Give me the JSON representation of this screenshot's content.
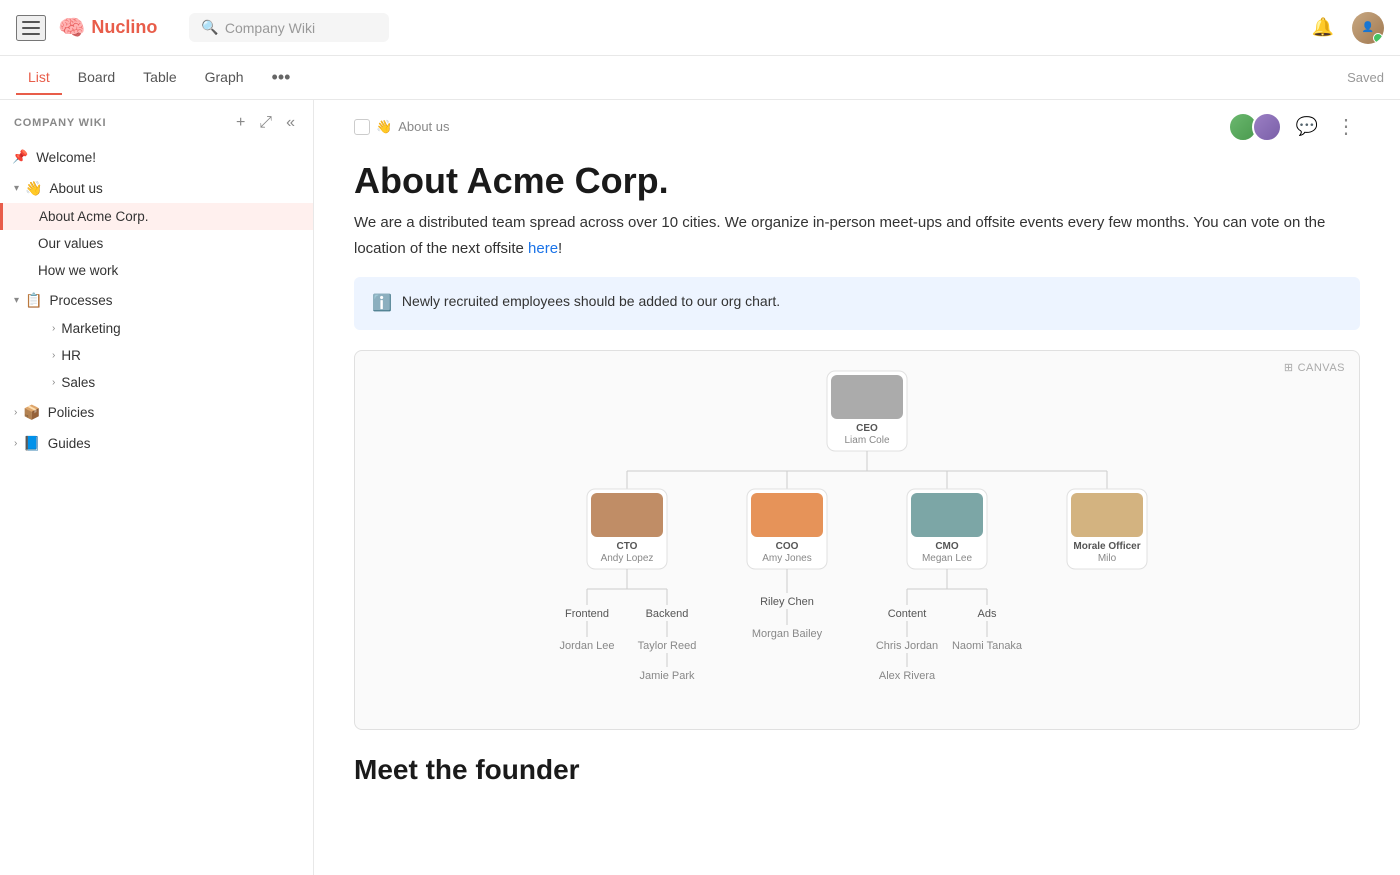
{
  "app": {
    "name": "Nuclino",
    "search_placeholder": "Company Wiki"
  },
  "tabs": [
    {
      "id": "list",
      "label": "List",
      "active": true
    },
    {
      "id": "board",
      "label": "Board",
      "active": false
    },
    {
      "id": "table",
      "label": "Table",
      "active": false
    },
    {
      "id": "graph",
      "label": "Graph",
      "active": false
    }
  ],
  "saved_label": "Saved",
  "sidebar": {
    "title": "COMPANY WIKI",
    "items": [
      {
        "id": "welcome",
        "label": "Welcome!",
        "icon": "📌",
        "type": "pinned"
      },
      {
        "id": "about-us",
        "label": "About us",
        "icon": "👋",
        "type": "group",
        "expanded": true,
        "children": [
          {
            "id": "about-acme",
            "label": "About Acme Corp.",
            "active": true
          },
          {
            "id": "our-values",
            "label": "Our values"
          },
          {
            "id": "how-we-work",
            "label": "How we work"
          }
        ]
      },
      {
        "id": "processes",
        "label": "Processes",
        "icon": "📋",
        "type": "group",
        "expanded": true,
        "children": [
          {
            "id": "marketing",
            "label": "Marketing",
            "hasChildren": true
          },
          {
            "id": "hr",
            "label": "HR",
            "hasChildren": true
          },
          {
            "id": "sales",
            "label": "Sales",
            "hasChildren": true
          }
        ]
      },
      {
        "id": "policies",
        "label": "Policies",
        "icon": "📦",
        "type": "group",
        "expanded": false
      },
      {
        "id": "guides",
        "label": "Guides",
        "icon": "📘",
        "type": "group",
        "expanded": false
      }
    ]
  },
  "document": {
    "breadcrumb": "About us",
    "breadcrumb_icon": "👋",
    "title": "About Acme Corp.",
    "body_text_1": "We are a distributed team spread across over 10 cities. We organize in-person meet-ups and offsite events every few months. You can vote on the location of the next offsite",
    "body_link": "here",
    "callout_text": "Newly recruited employees should be added to our org chart.",
    "canvas_label": "CANVAS",
    "meet_founder_title": "Meet the founder"
  },
  "org_chart": {
    "ceo": {
      "role": "CEO",
      "name": "Liam Cole"
    },
    "level2": [
      {
        "role": "CTO",
        "name": "Andy Lopez",
        "avatar_class": "av-brown"
      },
      {
        "role": "COO",
        "name": "Amy Jones",
        "avatar_class": "av-orange"
      },
      {
        "role": "CMO",
        "name": "Megan Lee",
        "avatar_class": "av-teal"
      },
      {
        "role": "Morale Officer",
        "name": "Milo",
        "avatar_class": "av-dog"
      }
    ],
    "cto_children": [
      {
        "label": "Frontend",
        "sub": "Jordan Lee"
      },
      {
        "label": "Backend",
        "sub": "Taylor Reed"
      }
    ],
    "coo_children": [
      {
        "label": "Riley Chen",
        "sub": "Morgan Bailey"
      }
    ],
    "cmo_children": [
      {
        "label": "Content",
        "sub": "Chris Jordan"
      },
      {
        "label": "Ads",
        "sub": "Naomi Tanaka"
      }
    ],
    "backend_sub": "Jamie Park",
    "content_sub": "Alex Rivera"
  },
  "icons": {
    "hamburger": "☰",
    "search": "🔍",
    "bell": "🔔",
    "more_horiz": "•••",
    "comment": "💬",
    "more_vert": "⋮",
    "plus": "+",
    "expand": "⤢",
    "collapse": "«",
    "info": "ℹ",
    "canvas": "⊞",
    "check": "☐"
  }
}
